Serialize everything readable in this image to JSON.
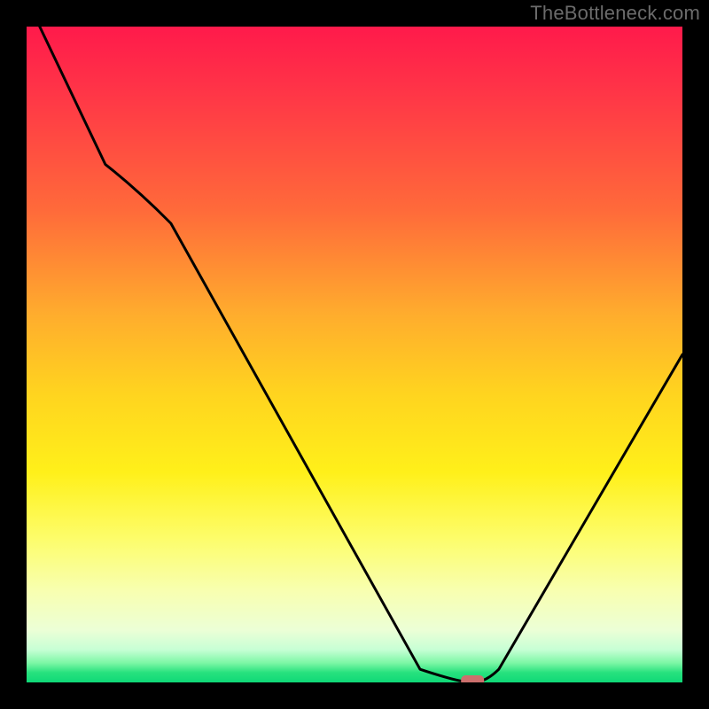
{
  "watermark": "TheBottleneck.com",
  "chart_data": {
    "type": "line",
    "title": "",
    "xlabel": "",
    "ylabel": "",
    "xlim": [
      0,
      100
    ],
    "ylim": [
      0,
      100
    ],
    "x": [
      2,
      12,
      22,
      60,
      66,
      70,
      72,
      100
    ],
    "values": [
      100,
      79,
      70,
      2,
      0,
      0,
      2,
      50
    ],
    "marker": {
      "x": 68,
      "y": 0
    },
    "background_gradient": {
      "stops": [
        {
          "pct": 0,
          "color": "#ff1a4b"
        },
        {
          "pct": 10,
          "color": "#ff3547"
        },
        {
          "pct": 28,
          "color": "#ff6a3a"
        },
        {
          "pct": 44,
          "color": "#ffad2d"
        },
        {
          "pct": 56,
          "color": "#ffd41f"
        },
        {
          "pct": 68,
          "color": "#fff01a"
        },
        {
          "pct": 78,
          "color": "#fdfd6a"
        },
        {
          "pct": 86,
          "color": "#f8ffb0"
        },
        {
          "pct": 92,
          "color": "#ecffd6"
        },
        {
          "pct": 95,
          "color": "#c7ffd5"
        },
        {
          "pct": 97,
          "color": "#7ef7a6"
        },
        {
          "pct": 98.5,
          "color": "#27e27e"
        },
        {
          "pct": 100,
          "color": "#0fd877"
        }
      ]
    }
  }
}
